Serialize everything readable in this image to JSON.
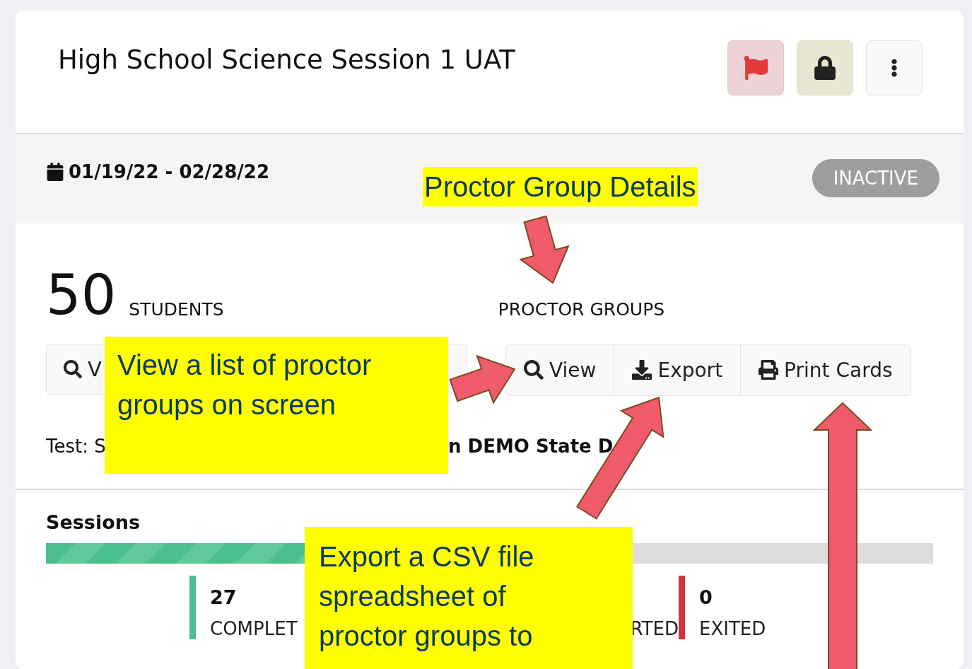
{
  "session": {
    "title": "High School Science Session 1 UAT",
    "date_range": "01/19/22 - 02/28/22",
    "status": "INACTIVE"
  },
  "students": {
    "count": "50",
    "label": "STUDENTS",
    "button": "V"
  },
  "proctor_groups": {
    "label": "PROCTOR GROUPS",
    "buttons": [
      {
        "kind": "view",
        "label": "View"
      },
      {
        "kind": "export",
        "label": "Export"
      },
      {
        "kind": "print",
        "label": "Print Cards"
      }
    ]
  },
  "test_line": [
    "Test: S",
    "n DEMO State D"
  ],
  "sessions": {
    "title": "Sessions",
    "level": 0.54,
    "stats": [
      {
        "value": "27",
        "label": "COMPLET",
        "color": "#4cbf8f"
      },
      {
        "label": "RTED"
      },
      {
        "value": "0",
        "label": "EXITED",
        "color": "#d0343e"
      }
    ]
  },
  "annotations": [
    {
      "kind": "heading",
      "text": "Proctor Group Details"
    },
    {
      "kind": "callout",
      "text": "View a list of proctor\ngroups on screen"
    },
    {
      "kind": "callout",
      "text": "Export a CSV file\nspreadsheet of\nproctor groups to"
    }
  ]
}
